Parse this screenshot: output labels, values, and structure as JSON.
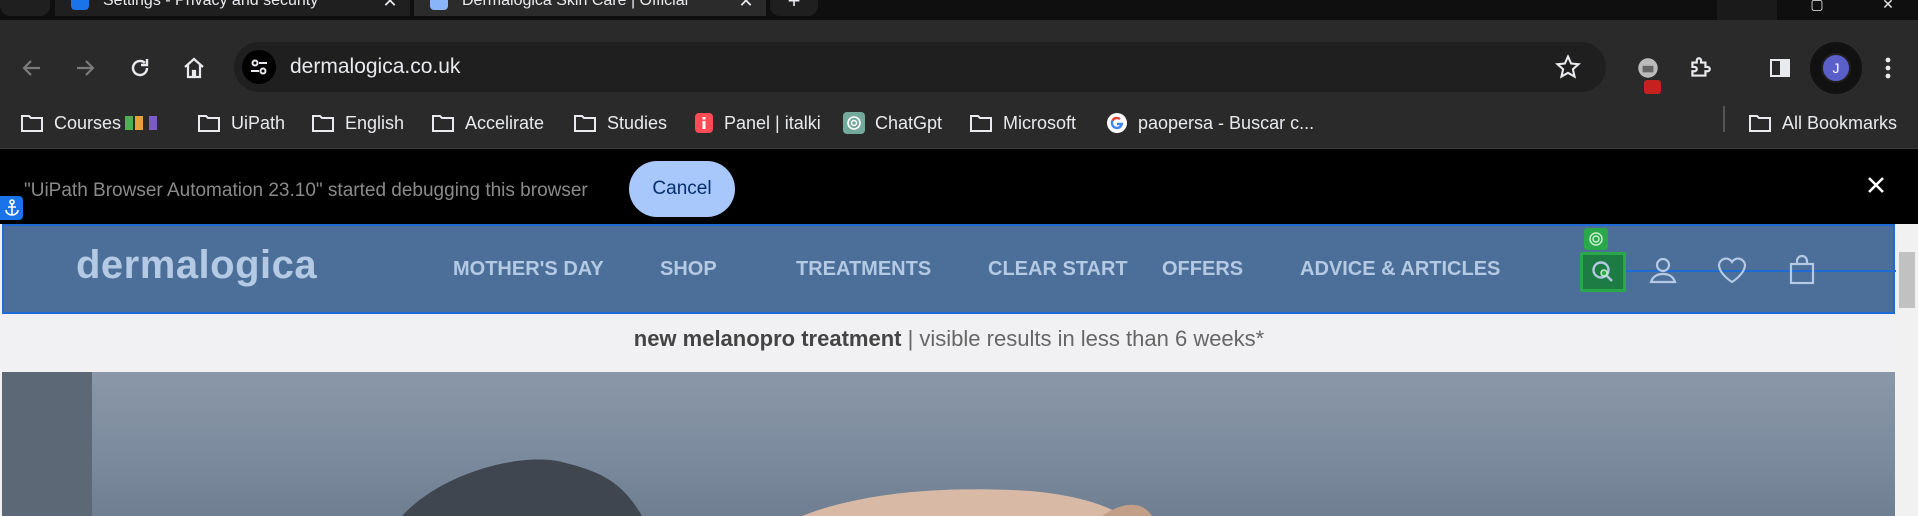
{
  "browser": {
    "tabs": [
      {
        "title": "Settings - Privacy and security",
        "active": false
      },
      {
        "title": "Dermalogica Skin Care | Official",
        "active": true
      }
    ],
    "new_tab_label": "+",
    "close_tab_glyph": "✕",
    "url": "dermalogica.co.uk",
    "profile_initial": "J",
    "window_controls": {
      "maximize": "▢",
      "close": "✕"
    }
  },
  "bookmarks": {
    "items": [
      {
        "label": "Courses",
        "icon": "folder-icon"
      },
      {
        "label": "UiPath",
        "icon": "folder-icon"
      },
      {
        "label": "English",
        "icon": "folder-icon"
      },
      {
        "label": "Accelirate",
        "icon": "folder-icon"
      },
      {
        "label": "Studies",
        "icon": "folder-icon"
      },
      {
        "label": "Panel | italki",
        "icon": "italki-icon"
      },
      {
        "label": "ChatGpt",
        "icon": "chatgpt-icon"
      },
      {
        "label": "Microsoft",
        "icon": "folder-icon"
      },
      {
        "label": "paopersa - Buscar c...",
        "icon": "google-icon"
      }
    ],
    "all_bookmarks": "All Bookmarks"
  },
  "debug_bar": {
    "message": "\"UiPath Browser Automation 23.10\" started debugging this browser",
    "cancel_label": "Cancel"
  },
  "site": {
    "logo": "dermalogica",
    "nav": [
      "MOTHER'S DAY",
      "SHOP",
      "TREATMENTS",
      "CLEAR START",
      "OFFERS",
      "ADVICE & ARTICLES"
    ],
    "promo_bold": "new melanopro treatment",
    "promo_rest": " | visible results in less than 6 weeks*"
  },
  "colors": {
    "header_overlay": "#4b6f98",
    "highlight_blue": "#1e6bd6",
    "target_green": "#2aa84a",
    "cancel_button": "#a8c7fa"
  }
}
